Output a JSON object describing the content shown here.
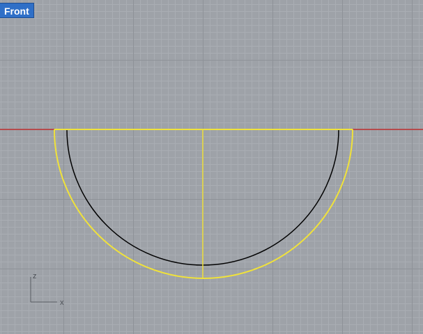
{
  "viewport": {
    "name": "Front",
    "axis_x_label": "x",
    "axis_z_label": "z"
  },
  "colors": {
    "background": "#9ea2a8",
    "grid_minor": "#a9adb3",
    "grid_major": "#8e9298",
    "world_x_axis": "#c03030",
    "selected_curve": "#f0e23a",
    "curve": "#000000",
    "tab_background": "#2f6fc7",
    "tab_text": "#ffffff"
  }
}
